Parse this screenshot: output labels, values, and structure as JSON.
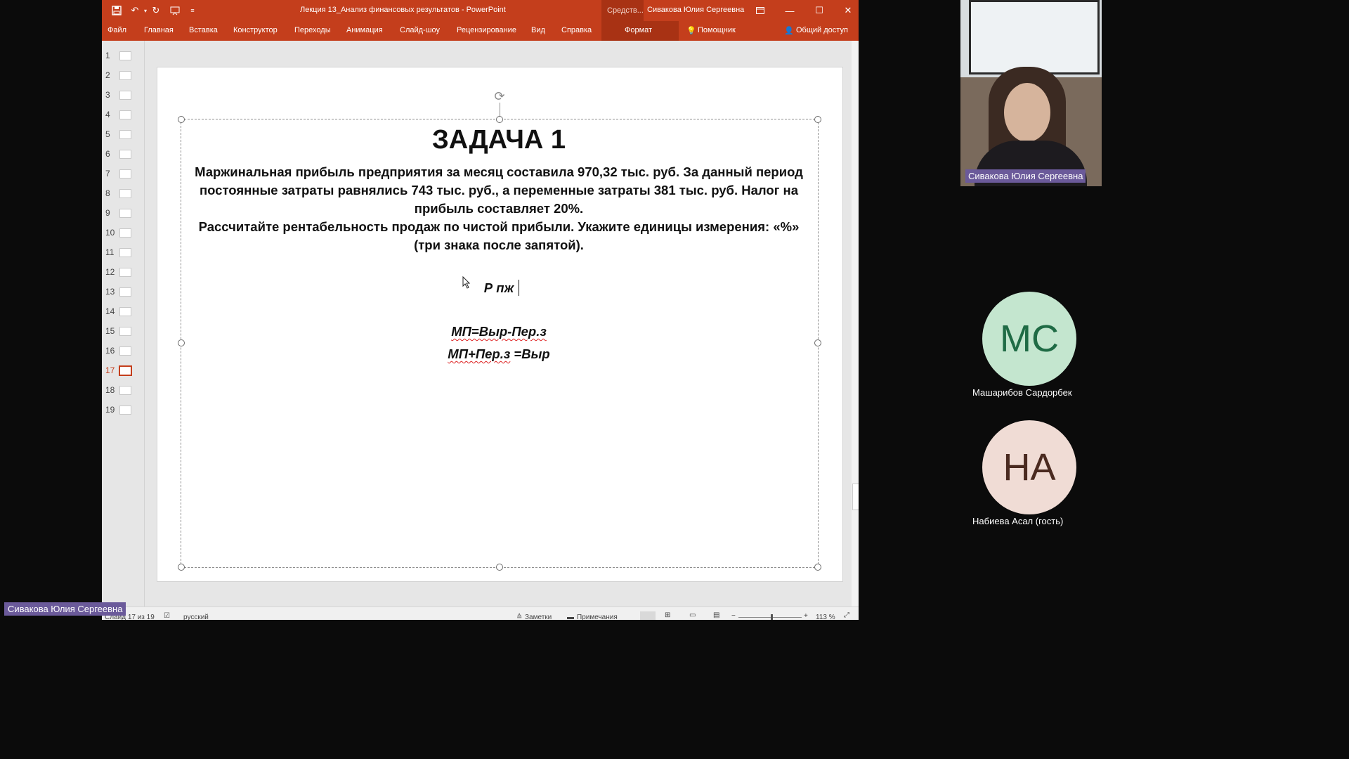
{
  "window": {
    "doc_title": "Лекция 13_Анализ финансовых результатов  -  PowerPoint",
    "context_group": "Средств...",
    "user": "Сивакова Юлия Сергеевна"
  },
  "ribbon": {
    "tabs": [
      "Файл",
      "Главная",
      "Вставка",
      "Конструктор",
      "Переходы",
      "Анимация",
      "Слайд-шоу",
      "Рецензирование",
      "Вид",
      "Справка"
    ],
    "format_tab": "Формат",
    "helper": "Помощник",
    "share": "Общий доступ"
  },
  "thumbnails": {
    "numbers": [
      "1",
      "2",
      "3",
      "4",
      "5",
      "6",
      "7",
      "8",
      "9",
      "10",
      "11",
      "12",
      "13",
      "14",
      "15",
      "16",
      "17",
      "18",
      "19"
    ],
    "active": "17"
  },
  "slide": {
    "title": "ЗАДАЧА 1",
    "body_lines": [
      "Маржинальная прибыль предприятия за месяц составила 970,32 тыс. руб. За данный период",
      "постоянные затраты равнялись 743 тыс. руб., а переменные затраты 381 тыс. руб. Налог на",
      "прибыль составляет 20%.",
      "Рассчитайте рентабельность продаж по чистой прибыли. Укажите единицы измерения: «%»",
      "(три знака после запятой)."
    ],
    "formula_1": "Р пж",
    "formula_2": "МП=Выр-Пер.з",
    "formula_3_a": "МП+Пер.з",
    "formula_3_b": " =Выр"
  },
  "statusbar": {
    "slide_info": "Слайд 17 из 19",
    "language": "русский",
    "notes": "Заметки",
    "comments": "Примечания",
    "zoom": "113 %"
  },
  "meeting": {
    "speaker_label": "Сивакова Юлия Сергеевна",
    "participants": [
      {
        "initials": "МС",
        "name": "Машарибов Сардорбек",
        "bg": "#c4e6cf",
        "fg": "#1f6b45"
      },
      {
        "initials": "НА",
        "name": "Набиева Асал (гость)",
        "bg": "#f0dcd5",
        "fg": "#4a2a20"
      }
    ],
    "bottom_label": "Сивакова Юлия Сергеевна"
  },
  "colors": {
    "ribbon": "#c43e1c",
    "context": "#a83214",
    "label_bg": "#6b5a9a"
  }
}
